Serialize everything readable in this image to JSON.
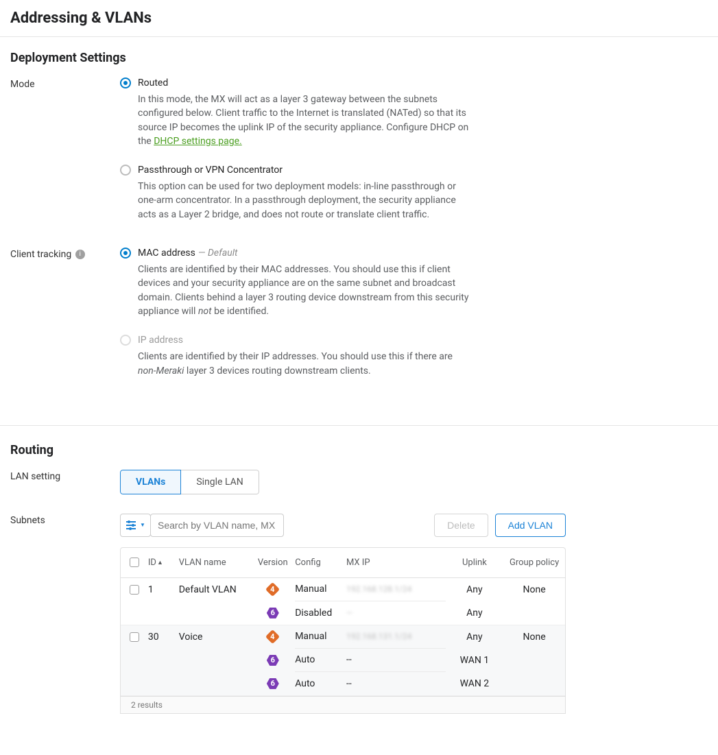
{
  "page": {
    "title": "Addressing & VLANs"
  },
  "deployment": {
    "heading": "Deployment Settings",
    "mode_label": "Mode",
    "mode_options": {
      "routed": {
        "label": "Routed",
        "desc_pre": "In this mode, the MX will act as a layer 3 gateway between the subnets configured below. Client traffic to the Internet is translated (NATed) so that its source IP becomes the uplink IP of the security appliance. Configure DHCP on the ",
        "link_text": "DHCP settings page."
      },
      "passthrough": {
        "label": "Passthrough or VPN Concentrator",
        "desc": "This option can be used for two deployment models: in-line passthrough or one-arm concentrator. In a passthrough deployment, the security appliance acts as a Layer 2 bridge, and does not route or translate client traffic."
      }
    },
    "tracking_label": "Client tracking",
    "tracking_options": {
      "mac": {
        "label": "MAC address",
        "default_tag": "— Default",
        "desc_pre": "Clients are identified by their MAC addresses. You should use this if client devices and your security appliance are on the same subnet and broadcast domain. Clients behind a layer 3 routing device downstream from this security appliance will ",
        "desc_em": "not",
        "desc_post": " be identified."
      },
      "ip": {
        "label": "IP address",
        "desc_pre": "Clients are identified by their IP addresses. You should use this if there are ",
        "desc_em": "non-Meraki",
        "desc_post": " layer 3 devices routing downstream clients."
      }
    }
  },
  "routing": {
    "heading": "Routing",
    "lan_label": "LAN setting",
    "tabs": {
      "vlans": "VLANs",
      "single": "Single LAN"
    },
    "subnets_label": "Subnets",
    "search_placeholder": "Search by VLAN name, MX IP",
    "delete_btn": "Delete",
    "add_btn": "Add VLAN",
    "columns": {
      "id": "ID",
      "name": "VLAN name",
      "version": "Version",
      "config": "Config",
      "mxip": "MX IP",
      "uplink": "Uplink",
      "group_policy": "Group policy"
    },
    "rows": [
      {
        "id": "1",
        "name": "Default VLAN",
        "group_policy": "None",
        "lines": [
          {
            "version": "4",
            "config": "Manual",
            "mxip": "192.168.128.1/24",
            "uplink": "Any"
          },
          {
            "version": "6",
            "config": "Disabled",
            "mxip": "—",
            "uplink": "Any"
          }
        ]
      },
      {
        "id": "30",
        "name": "Voice",
        "group_policy": "None",
        "lines": [
          {
            "version": "4",
            "config": "Manual",
            "mxip": "192.168.131.1/24",
            "uplink": "Any"
          },
          {
            "version": "6",
            "config": "Auto",
            "mxip": "--",
            "uplink": "WAN 1"
          },
          {
            "version": "6",
            "config": "Auto",
            "mxip": "--",
            "uplink": "WAN 2"
          }
        ]
      }
    ],
    "footer": "2 results"
  }
}
